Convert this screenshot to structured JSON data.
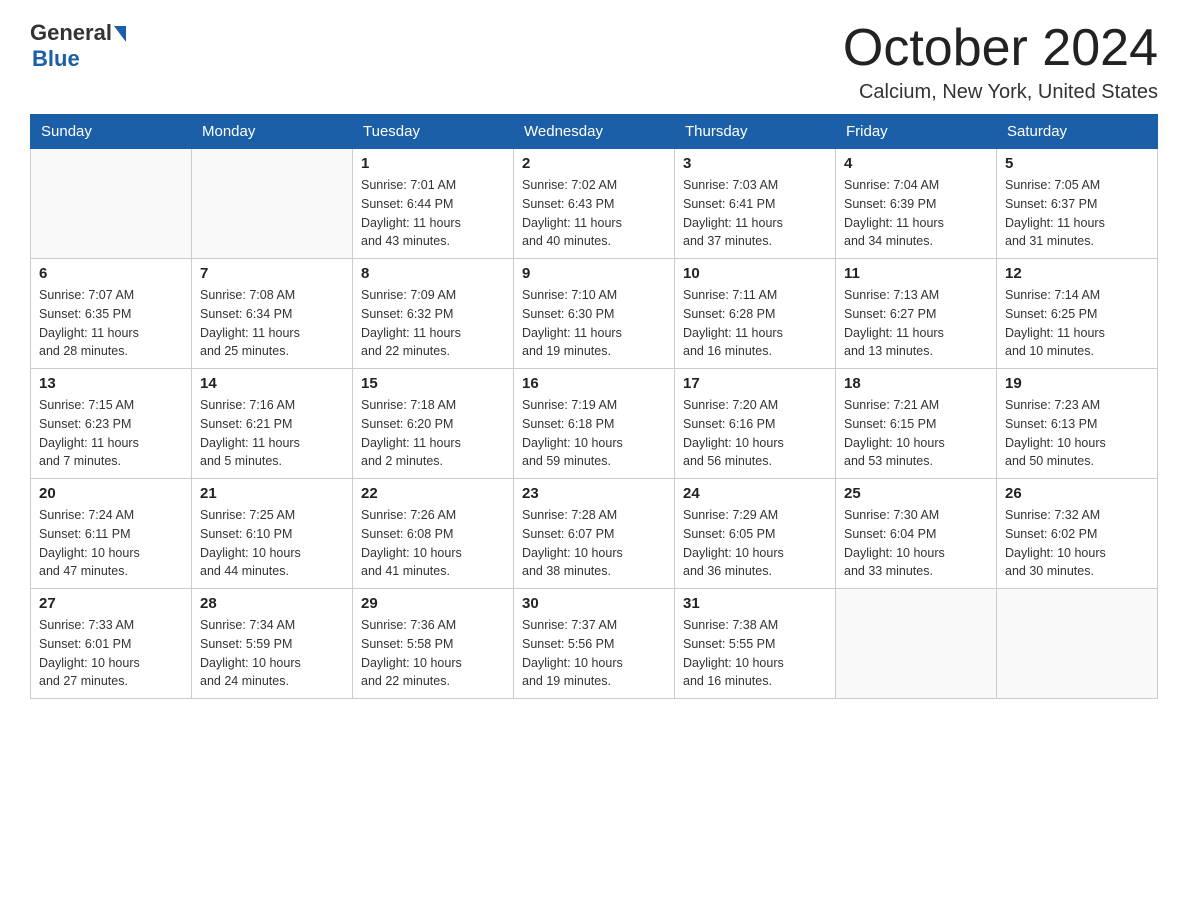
{
  "header": {
    "logo_general": "General",
    "logo_blue": "Blue",
    "month_title": "October 2024",
    "location": "Calcium, New York, United States"
  },
  "days_of_week": [
    "Sunday",
    "Monday",
    "Tuesday",
    "Wednesday",
    "Thursday",
    "Friday",
    "Saturday"
  ],
  "weeks": [
    [
      {
        "day": "",
        "info": ""
      },
      {
        "day": "",
        "info": ""
      },
      {
        "day": "1",
        "info": "Sunrise: 7:01 AM\nSunset: 6:44 PM\nDaylight: 11 hours\nand 43 minutes."
      },
      {
        "day": "2",
        "info": "Sunrise: 7:02 AM\nSunset: 6:43 PM\nDaylight: 11 hours\nand 40 minutes."
      },
      {
        "day": "3",
        "info": "Sunrise: 7:03 AM\nSunset: 6:41 PM\nDaylight: 11 hours\nand 37 minutes."
      },
      {
        "day": "4",
        "info": "Sunrise: 7:04 AM\nSunset: 6:39 PM\nDaylight: 11 hours\nand 34 minutes."
      },
      {
        "day": "5",
        "info": "Sunrise: 7:05 AM\nSunset: 6:37 PM\nDaylight: 11 hours\nand 31 minutes."
      }
    ],
    [
      {
        "day": "6",
        "info": "Sunrise: 7:07 AM\nSunset: 6:35 PM\nDaylight: 11 hours\nand 28 minutes."
      },
      {
        "day": "7",
        "info": "Sunrise: 7:08 AM\nSunset: 6:34 PM\nDaylight: 11 hours\nand 25 minutes."
      },
      {
        "day": "8",
        "info": "Sunrise: 7:09 AM\nSunset: 6:32 PM\nDaylight: 11 hours\nand 22 minutes."
      },
      {
        "day": "9",
        "info": "Sunrise: 7:10 AM\nSunset: 6:30 PM\nDaylight: 11 hours\nand 19 minutes."
      },
      {
        "day": "10",
        "info": "Sunrise: 7:11 AM\nSunset: 6:28 PM\nDaylight: 11 hours\nand 16 minutes."
      },
      {
        "day": "11",
        "info": "Sunrise: 7:13 AM\nSunset: 6:27 PM\nDaylight: 11 hours\nand 13 minutes."
      },
      {
        "day": "12",
        "info": "Sunrise: 7:14 AM\nSunset: 6:25 PM\nDaylight: 11 hours\nand 10 minutes."
      }
    ],
    [
      {
        "day": "13",
        "info": "Sunrise: 7:15 AM\nSunset: 6:23 PM\nDaylight: 11 hours\nand 7 minutes."
      },
      {
        "day": "14",
        "info": "Sunrise: 7:16 AM\nSunset: 6:21 PM\nDaylight: 11 hours\nand 5 minutes."
      },
      {
        "day": "15",
        "info": "Sunrise: 7:18 AM\nSunset: 6:20 PM\nDaylight: 11 hours\nand 2 minutes."
      },
      {
        "day": "16",
        "info": "Sunrise: 7:19 AM\nSunset: 6:18 PM\nDaylight: 10 hours\nand 59 minutes."
      },
      {
        "day": "17",
        "info": "Sunrise: 7:20 AM\nSunset: 6:16 PM\nDaylight: 10 hours\nand 56 minutes."
      },
      {
        "day": "18",
        "info": "Sunrise: 7:21 AM\nSunset: 6:15 PM\nDaylight: 10 hours\nand 53 minutes."
      },
      {
        "day": "19",
        "info": "Sunrise: 7:23 AM\nSunset: 6:13 PM\nDaylight: 10 hours\nand 50 minutes."
      }
    ],
    [
      {
        "day": "20",
        "info": "Sunrise: 7:24 AM\nSunset: 6:11 PM\nDaylight: 10 hours\nand 47 minutes."
      },
      {
        "day": "21",
        "info": "Sunrise: 7:25 AM\nSunset: 6:10 PM\nDaylight: 10 hours\nand 44 minutes."
      },
      {
        "day": "22",
        "info": "Sunrise: 7:26 AM\nSunset: 6:08 PM\nDaylight: 10 hours\nand 41 minutes."
      },
      {
        "day": "23",
        "info": "Sunrise: 7:28 AM\nSunset: 6:07 PM\nDaylight: 10 hours\nand 38 minutes."
      },
      {
        "day": "24",
        "info": "Sunrise: 7:29 AM\nSunset: 6:05 PM\nDaylight: 10 hours\nand 36 minutes."
      },
      {
        "day": "25",
        "info": "Sunrise: 7:30 AM\nSunset: 6:04 PM\nDaylight: 10 hours\nand 33 minutes."
      },
      {
        "day": "26",
        "info": "Sunrise: 7:32 AM\nSunset: 6:02 PM\nDaylight: 10 hours\nand 30 minutes."
      }
    ],
    [
      {
        "day": "27",
        "info": "Sunrise: 7:33 AM\nSunset: 6:01 PM\nDaylight: 10 hours\nand 27 minutes."
      },
      {
        "day": "28",
        "info": "Sunrise: 7:34 AM\nSunset: 5:59 PM\nDaylight: 10 hours\nand 24 minutes."
      },
      {
        "day": "29",
        "info": "Sunrise: 7:36 AM\nSunset: 5:58 PM\nDaylight: 10 hours\nand 22 minutes."
      },
      {
        "day": "30",
        "info": "Sunrise: 7:37 AM\nSunset: 5:56 PM\nDaylight: 10 hours\nand 19 minutes."
      },
      {
        "day": "31",
        "info": "Sunrise: 7:38 AM\nSunset: 5:55 PM\nDaylight: 10 hours\nand 16 minutes."
      },
      {
        "day": "",
        "info": ""
      },
      {
        "day": "",
        "info": ""
      }
    ]
  ]
}
